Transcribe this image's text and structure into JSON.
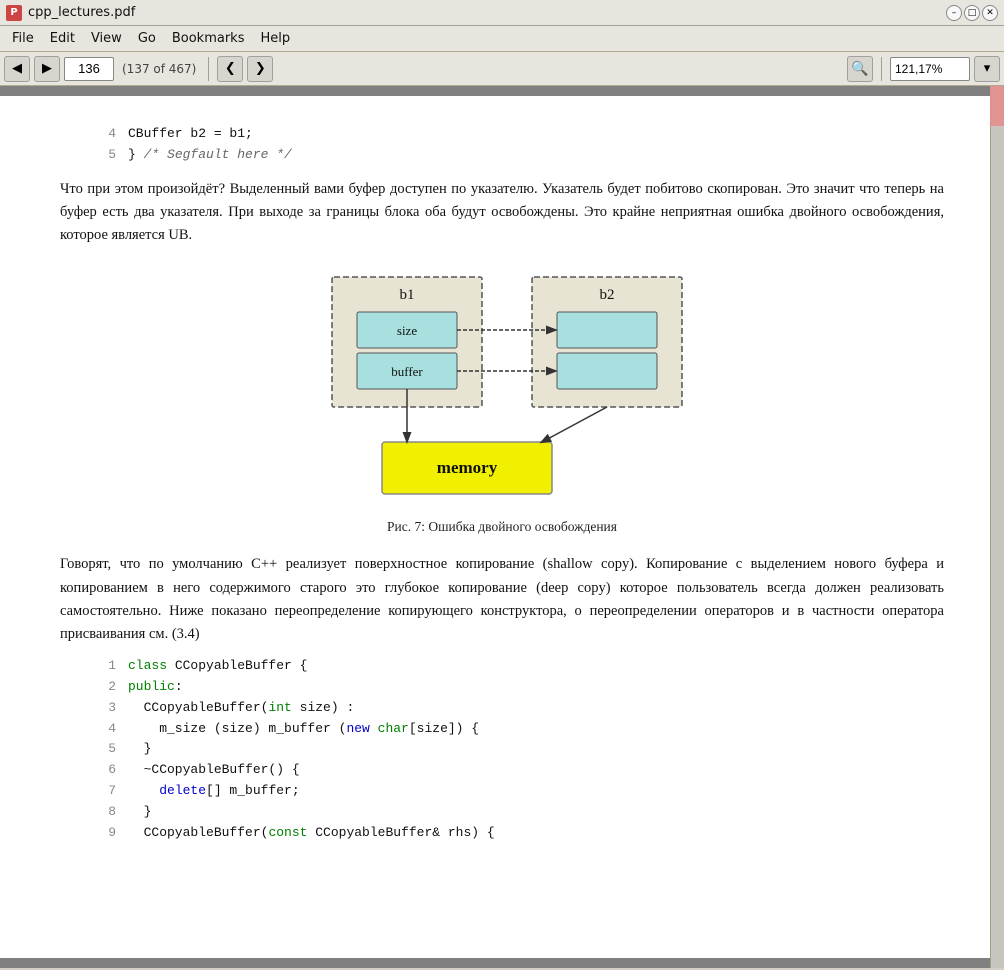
{
  "titlebar": {
    "title": "cpp_lectures.pdf",
    "icon_label": "pdf",
    "controls": [
      "minimize",
      "maximize",
      "close"
    ]
  },
  "menubar": {
    "items": [
      "File",
      "Edit",
      "View",
      "Go",
      "Bookmarks",
      "Help"
    ]
  },
  "toolbar": {
    "back_label": "◀",
    "forward_label": "▶",
    "page_value": "136",
    "page_info": "(137 of 467)",
    "prev_label": "❮",
    "next_label": "❯",
    "zoom_value": "121,17%",
    "search_icon": "🔍"
  },
  "code_top": [
    {
      "num": "4",
      "text": "CBuffer b2 = b1;"
    },
    {
      "num": "5",
      "text": "} /* Segfault here */"
    }
  ],
  "para1": "Что при этом произойдёт? Выделенный вами буфер доступен по указателю. Указатель будет побитово скопирован. Это значит что теперь на буфер есть два указателя. При выходе за границы блока оба будут освобождены. Это крайне неприятная ошибка двойного освобождения, которое является UB.",
  "diagram": {
    "b1_label": "b1",
    "b2_label": "b2",
    "size_label": "size",
    "buffer_label": "buffer",
    "memory_label": "memory"
  },
  "fig_caption": "Рис. 7: Ошибка двойного освобождения",
  "para2": "Говорят, что по умолчанию C++ реализует поверхностное копирование (shallow copy). Копирование с выделением нового буфера и копированием в него содержимого старого это глубокое копирование (deep copy) которое пользователь всегда должен реализовать самостоятельно. Ниже показано переопределение копирующего конструктора, о переопределении операторов и в частности оператора присваивания см. (3.4)",
  "code_bottom": [
    {
      "num": "1",
      "type": "class_line",
      "text": "class CCopyableBuffer {"
    },
    {
      "num": "2",
      "type": "access",
      "text": "public:"
    },
    {
      "num": "3",
      "type": "constructor",
      "text": "CCopyableBuffer(int size) :"
    },
    {
      "num": "4",
      "type": "init",
      "text": "    m_size (size) m_buffer (new char[size]) {"
    },
    {
      "num": "5",
      "type": "brace",
      "text": "}"
    },
    {
      "num": "6",
      "type": "destructor",
      "text": "~CCopyableBuffer() {"
    },
    {
      "num": "7",
      "type": "delete",
      "text": "    delete[] m_buffer;"
    },
    {
      "num": "8",
      "type": "brace",
      "text": "}"
    },
    {
      "num": "9",
      "type": "copy_constructor",
      "text": "CCopyableBuffer(const CCopyableBuffer& rhs) {"
    }
  ]
}
